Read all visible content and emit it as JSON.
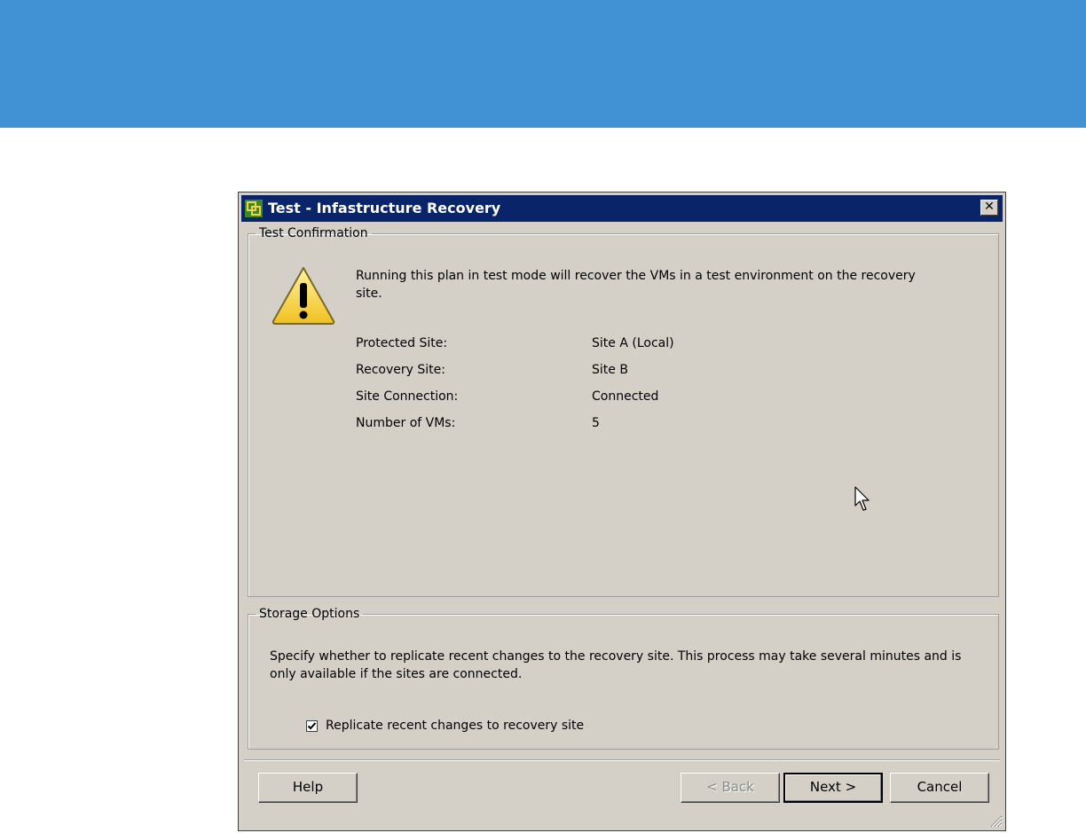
{
  "dialog": {
    "title": "Test - Infastructure Recovery",
    "close_symbol": "✕"
  },
  "test_confirmation": {
    "legend": "Test Confirmation",
    "message": "Running this plan in test mode will recover the VMs in a test environment on the recovery site.",
    "protected_site_label": "Protected Site:",
    "protected_site_value": "Site A (Local)",
    "recovery_site_label": "Recovery Site:",
    "recovery_site_value": "Site B",
    "site_connection_label": "Site Connection:",
    "site_connection_value": "Connected",
    "num_vms_label": "Number of VMs:",
    "num_vms_value": "5"
  },
  "storage_options": {
    "legend": "Storage Options",
    "description": "Specify whether to replicate recent changes to the recovery site. This process may take several minutes and is only available if the sites are connected.",
    "checkbox_label": "Replicate recent changes to recovery site",
    "checkbox_checked": true
  },
  "buttons": {
    "help": "Help",
    "back": "< Back",
    "next": "Next >",
    "cancel": "Cancel"
  },
  "colors": {
    "banner": "#4192d5",
    "titlebar": "#0a246a",
    "dialog_bg": "#d4d0c8"
  }
}
